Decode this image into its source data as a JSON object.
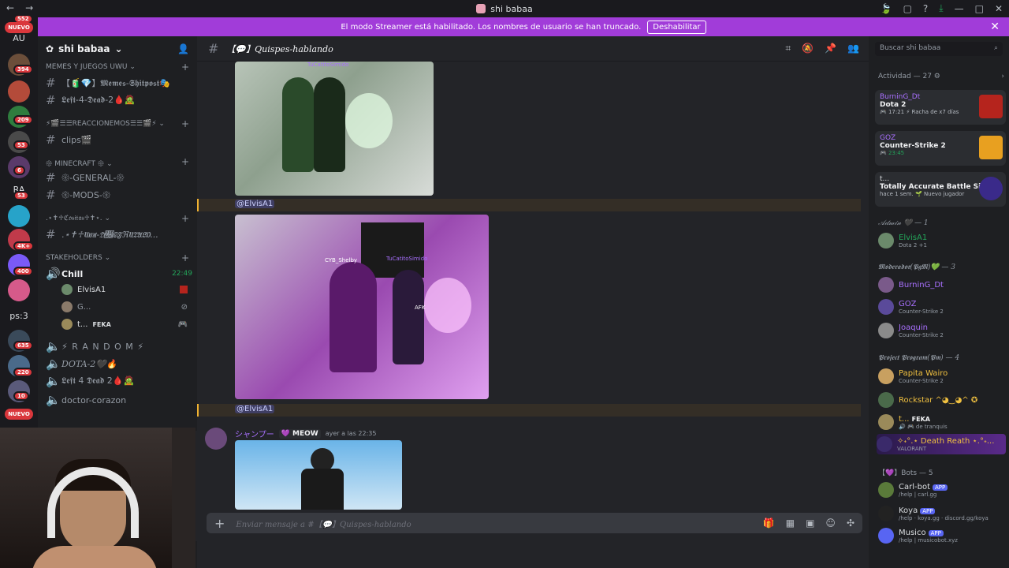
{
  "window": {
    "title": "shi babaa"
  },
  "banner": {
    "text": "El modo Streamer está habilitado. Los nombres de usuario se han truncado.",
    "button": "Deshabilitar"
  },
  "guilds": {
    "badges": [
      "552",
      "394",
      "209",
      "53",
      "6",
      "53",
      "4K+",
      "400",
      "635",
      "220",
      "10"
    ],
    "labels": [
      "AU",
      "RA",
      "ps:3"
    ],
    "nuevo": "NUEVO"
  },
  "server": {
    "name": "shi babaa"
  },
  "channels": {
    "cat1": "MEMES Y JUEGOS UWU",
    "ch1": "【🧃💎】𝕸𝖊𝖒𝖊𝖘-𝕾𝖍𝖎𝖙𝖕𝖔𝖘𝖙🎭",
    "ch2": "𝕷𝖊𝖋𝖙-4-𝕯𝖊𝖆𝖉-2🩸🧟",
    "cat2": "⚡🎬☰☰REACCIONEMOS☰☰🎬⚡",
    "ch3": "clips🎬",
    "cat3": "𑁍 MINECRAFT 𑁍",
    "ch4": "𑁍-GENERAL-𑁍",
    "ch5": "𑁍-MODS-𑁍",
    "cat4": ".⋆✝︎♱ℭ𝔬𝔰𝔦𝔱𝔞𝔰♱✝︎⋆.",
    "ch6": ".⋆✝︎♱𝔘𝔴𝔲-𝔇𝔌𝔖𝔉ℜ𝔘𝔗𝔄𝔏𝔒...",
    "cat5": "STAKEHOLDERS",
    "voice1": "Chill",
    "voice1_time": "22:49",
    "vu1": "ElvisA1",
    "vu2": "G...",
    "vu3": "t...",
    "vu3_tag": "FEKA",
    "voice2": "⚡ R A N D O M ⚡",
    "voice3": "DOTA-2🖤🔥",
    "voice4": "𝕷𝖊𝖋𝖙 4 𝕯𝖊𝖆𝖉 2🩸🧟",
    "voice5": "doctor-corazon"
  },
  "chat": {
    "channel": "【💬】Quispes-hablando",
    "mention1": "@ElvisA1",
    "mention2": "@ElvisA1",
    "author": "シャンプー",
    "tag": "MEOW",
    "time": "ayer a las 22:35",
    "img1_label": "TuCatitoSimido",
    "img2_label1": "CYB_Shelby",
    "img2_label2": "TuCatitoSimido",
    "img2_afk": "AFK",
    "placeholder": "Enviar mensaje a #【💬】Quispes-hablando"
  },
  "members": {
    "search": "Buscar shi babaa",
    "activity": "Actividad — 27",
    "act1": {
      "user": "BurninG_Dt",
      "game": "Dota 2",
      "status": "🎮 17:21  ⚡ Racha de x7 días"
    },
    "act2": {
      "user": "GOZ",
      "game": "Counter-Strike 2",
      "status": "🎮 23:45"
    },
    "act3": {
      "user": "t...",
      "game": "Totally Accurate Battle Si...",
      "status": "hace 1 sem.  🌱 Nuevo jugador"
    },
    "role1": "𝒜𝒹𝓂𝒾𝓃 🖤 — 1",
    "m1": {
      "name": "ElvisA1",
      "sub": "Dota 2 +1"
    },
    "role2": "𝕸𝖔𝖉𝖊𝖗𝖆𝖉𝖔𝖗(𝕻𝖌𝕸)💚 — 3",
    "m2": {
      "name": "BurninG_Dt",
      "sub": ""
    },
    "m3": {
      "name": "GOZ",
      "sub": "Counter-Strike 2"
    },
    "m4": {
      "name": "Joaquin",
      "sub": "Counter-Strike 2"
    },
    "role3": "𝕻𝖗𝖔𝖏𝖊𝖈𝖙 𝕻𝖗𝖔𝖌𝖗𝖆𝖒(𝕻𝖒) — 4",
    "m5": {
      "name": "Papita Wairo",
      "sub": "Counter-Strike 2"
    },
    "m6": {
      "name": "Rockstar ^◕‿◕^ ✪",
      "sub": ""
    },
    "m7": {
      "name": "t...",
      "tag": "FEKA",
      "sub": "🔊 🎮 de tranquis"
    },
    "m8": {
      "name": "✧˖°.⋆ Death Reath ⋆.°˖...",
      "sub": "VALORANT"
    },
    "role4": "【💜】Bots — 5",
    "b1": {
      "name": "Carl-bot",
      "sub": "/help | carl.gg"
    },
    "b2": {
      "name": "Koya",
      "sub": "/help · koya.gg · discord.gg/koya"
    },
    "b3": {
      "name": "Musico",
      "sub": "/help | musicobot.xyz"
    },
    "app": "APP"
  },
  "colors": {
    "accent": "#a13cd9",
    "brand": "#5865f2",
    "online": "#23a55a"
  }
}
